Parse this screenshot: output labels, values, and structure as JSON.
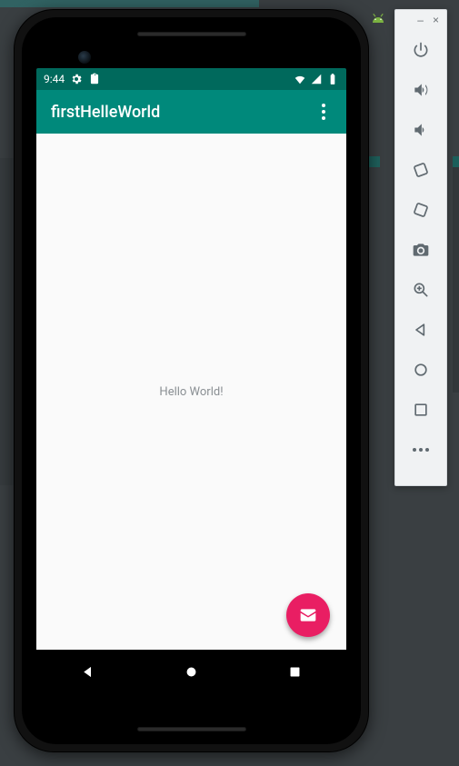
{
  "statusbar": {
    "time": "9:44"
  },
  "appbar": {
    "title": "firstHelleWorld"
  },
  "content": {
    "message": "Hello World!"
  },
  "colors": {
    "primary": "#00897b",
    "primaryDark": "#00695c",
    "fab": "#e91e63"
  }
}
